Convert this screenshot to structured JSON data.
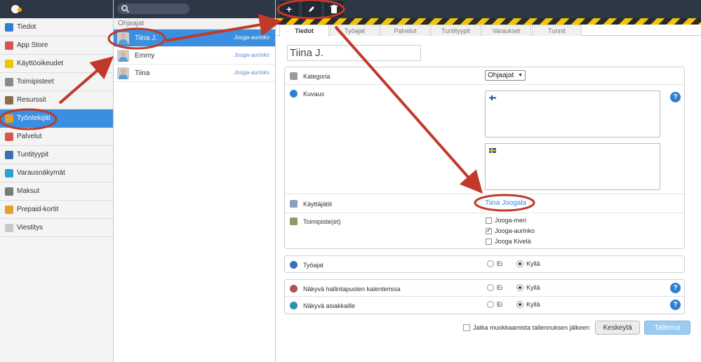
{
  "sidebar": {
    "items": [
      {
        "label": "Tiedot",
        "icon": "info-icon",
        "color": "#2f7fd0"
      },
      {
        "label": "App Store",
        "icon": "app-store-icon",
        "color": "#d9534f"
      },
      {
        "label": "Käyttöoikeudet",
        "icon": "star-icon",
        "color": "#f0c400"
      },
      {
        "label": "Toimipisteet",
        "icon": "building-icon",
        "color": "#8a8a8a"
      },
      {
        "label": "Resurssit",
        "icon": "resources-icon",
        "color": "#8a6d4a"
      },
      {
        "label": "Työntekijät",
        "icon": "staff-icon",
        "color": "#e0a030"
      },
      {
        "label": "Palvelut",
        "icon": "services-icon",
        "color": "#d9534f"
      },
      {
        "label": "Tuntityypit",
        "icon": "calendar-icon",
        "color": "#3b6fb0"
      },
      {
        "label": "Varausnäkymät",
        "icon": "globe-icon",
        "color": "#2f9fd0"
      },
      {
        "label": "Maksut",
        "icon": "payments-icon",
        "color": "#7a7a7a"
      },
      {
        "label": "Prepaid-kortit",
        "icon": "card-icon",
        "color": "#e0a030"
      },
      {
        "label": "Viestitys",
        "icon": "messaging-icon",
        "color": "#c8c8c8"
      }
    ],
    "active_index": 5
  },
  "list": {
    "group_title": "Ohjaajat",
    "people": [
      {
        "name": "Tiina J.",
        "location": "Jooga-aurinko"
      },
      {
        "name": "Emmy",
        "location": "Jooga-aurinko"
      },
      {
        "name": "Tiina",
        "location": "Jooga-aurinko"
      }
    ]
  },
  "toolbar": {
    "add_icon": "plus-icon",
    "edit_icon": "pencil-icon",
    "delete_icon": "trash-icon"
  },
  "tabs": [
    "Tiedot",
    "Työajat",
    "Palvelut",
    "Tuntityypit",
    "Varaukset",
    "Tunnit"
  ],
  "form": {
    "name_value": "Tiina J.",
    "category_label": "Kategoria",
    "category_value": "Ohjaajat",
    "description_label": "Kuvaus",
    "user_account_label": "Käyttäjätili",
    "user_account_value": "Tiina Joogala",
    "locations_label": "Toimipiste(et)",
    "locations": [
      {
        "label": "Jooga-meri",
        "checked": false
      },
      {
        "label": "Jooga-aurinko",
        "checked": true
      },
      {
        "label": "Jooga Kivelä",
        "checked": false
      }
    ],
    "work_hours_label": "Työajat",
    "admin_calendar_label": "Näkyvä hallintapuolen kalenterissa",
    "customers_label": "Näkyvä asiakkaille",
    "no_label": "Ei",
    "yes_label": "Kyllä",
    "help_label": "?"
  },
  "footer": {
    "continue_label": "Jatka muokkaamista tallennuksen jälkeen",
    "cancel_label": "Keskeytä",
    "save_label": "Tallenna"
  },
  "colors": {
    "accent": "#3b8fe0",
    "annotation": "#c0392b",
    "topbar": "#2e3746"
  }
}
